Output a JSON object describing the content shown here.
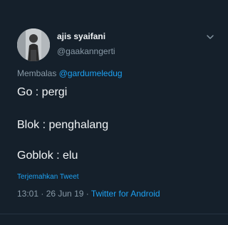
{
  "tweet": {
    "user": {
      "display_name": "ajis syaifani",
      "handle": "@gaakanngerti"
    },
    "reply": {
      "prefix": "Membalas",
      "mention": "@gardumeledug"
    },
    "lines": [
      "Go : pergi",
      "Blok : penghalang",
      "Goblok : elu"
    ],
    "translate_label": "Terjemahkan Tweet",
    "meta": {
      "time": "13:01",
      "separator1": " · ",
      "date": "26 Jun 19",
      "separator2": " · ",
      "source": "Twitter for Android"
    }
  },
  "colors": {
    "background": "#15202b",
    "accent": "#1da1f2",
    "secondary_text": "#8899a6",
    "primary_text": "#f2f5f7"
  },
  "icons": {
    "menu": "chevron-down-icon",
    "avatar": "profile-photo"
  }
}
